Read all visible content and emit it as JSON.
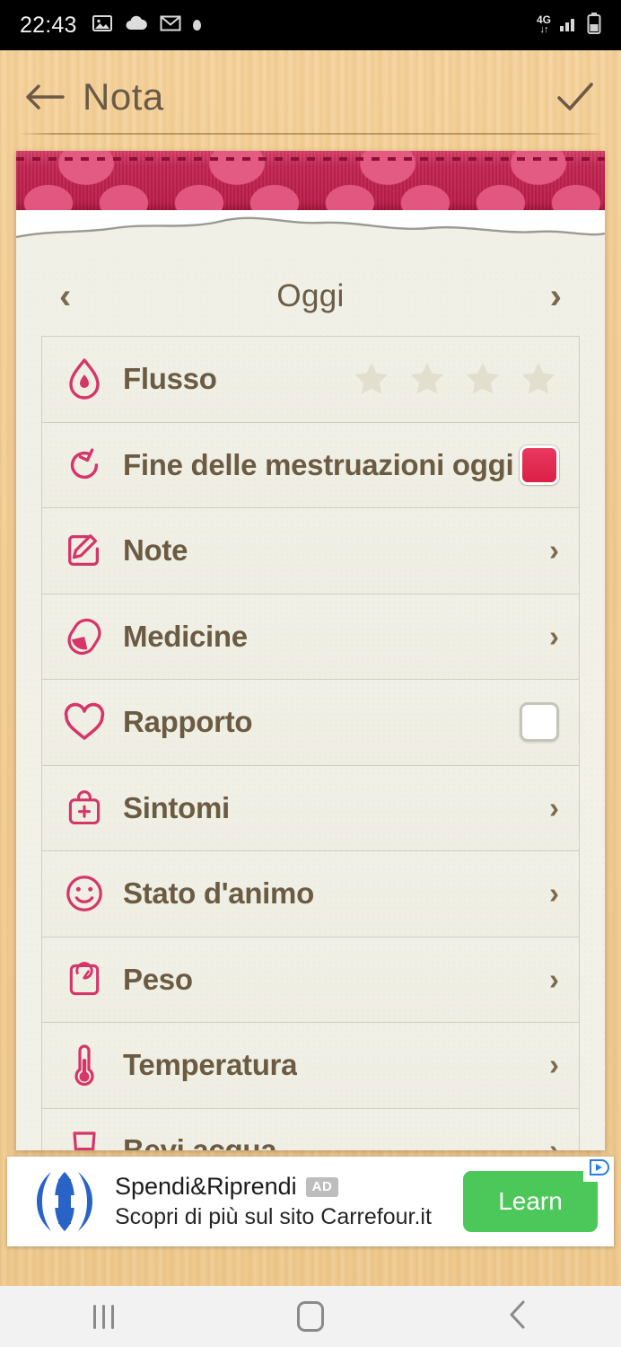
{
  "status_bar": {
    "time": "22:43",
    "left_icons": [
      "image-icon",
      "cloud-icon",
      "gmail-icon",
      "dot-icon"
    ],
    "network": "4G",
    "right_icons": [
      "signal-icon",
      "battery-icon"
    ]
  },
  "app_bar": {
    "back_icon": "arrow-left-icon",
    "title": "Nota",
    "confirm_icon": "check-icon"
  },
  "date_nav": {
    "prev_icon": "chevron-left-icon",
    "label": "Oggi",
    "next_icon": "chevron-right-icon"
  },
  "rows": [
    {
      "label": "Flusso",
      "icon": "droplet-icon",
      "control": "stars",
      "stars_total": 4,
      "stars_filled": 0
    },
    {
      "label": "Fine delle mestruazioni oggi",
      "icon": "cycle-end-icon",
      "control": "checkbox",
      "checked": true
    },
    {
      "label": "Note",
      "icon": "pencil-note-icon",
      "control": "chevron",
      "chevron": "›"
    },
    {
      "label": "Medicine",
      "icon": "pill-icon",
      "control": "chevron",
      "chevron": "›"
    },
    {
      "label": "Rapporto",
      "icon": "heart-icon",
      "control": "checkbox",
      "checked": false
    },
    {
      "label": "Sintomi",
      "icon": "medical-bag-icon",
      "control": "chevron",
      "chevron": "›"
    },
    {
      "label": "Stato d'animo",
      "icon": "smiley-icon",
      "control": "chevron",
      "chevron": "›"
    },
    {
      "label": "Peso",
      "icon": "scale-icon",
      "control": "chevron",
      "chevron": "›"
    },
    {
      "label": "Temperatura",
      "icon": "thermometer-icon",
      "control": "chevron",
      "chevron": "›"
    },
    {
      "label": "Bevi acqua",
      "icon": "water-glass-icon",
      "control": "chevron",
      "chevron": "›"
    }
  ],
  "ad": {
    "logo_icon": "carrefour-logo-icon",
    "title": "Spendi&Riprendi",
    "badge": "AD",
    "subtitle": "Scopri di più sul sito Carrefour.it",
    "cta_label": "Learn",
    "adchoices_icon": "adchoices-icon"
  },
  "nav_bar": {
    "recents_icon": "recents-icon",
    "home_icon": "home-icon",
    "back_icon": "nav-back-icon"
  },
  "colors": {
    "accent_pink": "#D6356A",
    "ribbon_red": "#C22552",
    "label_brown": "#6B5B43",
    "wood": "#F2CC92",
    "paper": "#F1F0E6",
    "checkbox_checked": "#DC1F46",
    "cta_green": "#4CC85A",
    "carrefour_blue": "#2A63C6"
  }
}
